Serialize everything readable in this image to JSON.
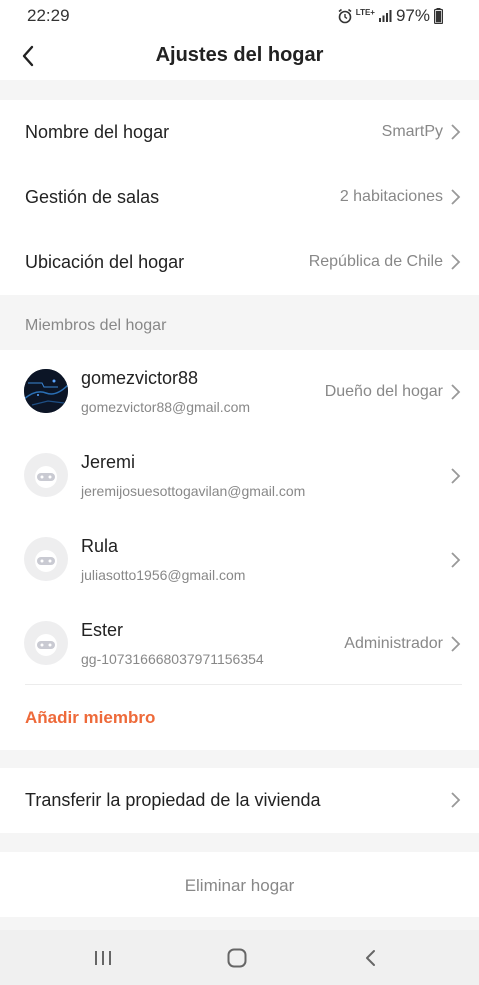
{
  "status_bar": {
    "time": "22:29",
    "network": "LTE+",
    "battery": "97%"
  },
  "header": {
    "title": "Ajustes del hogar"
  },
  "home_info": {
    "name_label": "Nombre del hogar",
    "name_value": "SmartPy",
    "rooms_label": "Gestión de salas",
    "rooms_value": "2 habitaciones",
    "location_label": "Ubicación del hogar",
    "location_value": "República de Chile"
  },
  "members_section": {
    "title": "Miembros del hogar",
    "members": [
      {
        "name": "gomezvictor88",
        "email": "gomezvictor88@gmail.com",
        "role": "Dueño del hogar"
      },
      {
        "name": "Jeremi",
        "email": "jeremijosuesottogavilan@gmail.com",
        "role": ""
      },
      {
        "name": "Rula",
        "email": "juliasotto1956@gmail.com",
        "role": ""
      },
      {
        "name": "Ester",
        "email": "gg-107316668037971156354",
        "role": "Administrador"
      }
    ],
    "add_member": "Añadir miembro"
  },
  "transfer": {
    "label": "Transferir la propiedad de la vivienda"
  },
  "delete": {
    "label": "Eliminar hogar"
  },
  "colors": {
    "accent": "#ee6a3a",
    "background": "#f5f5f5",
    "card": "#ffffff",
    "muted_text": "#888888"
  }
}
